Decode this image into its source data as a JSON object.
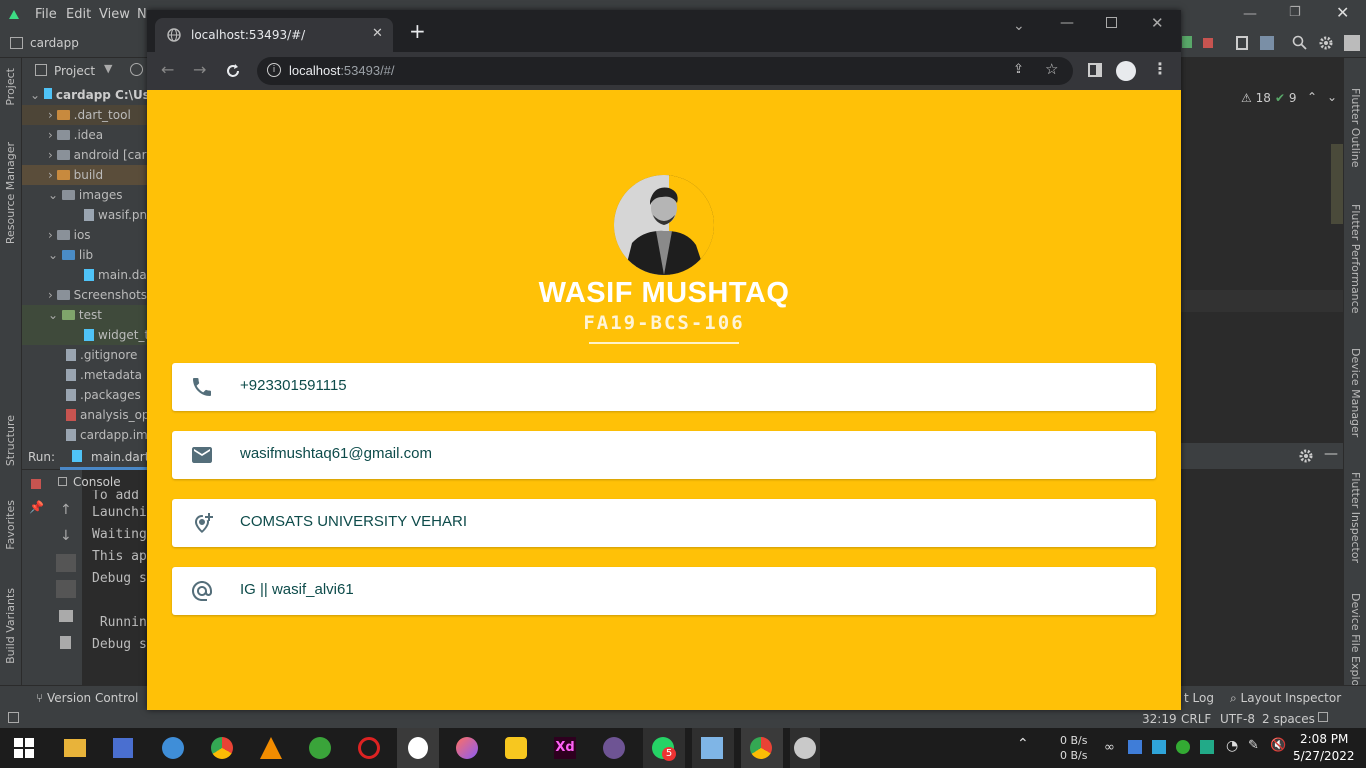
{
  "ide": {
    "menu": [
      "File",
      "Edit",
      "View",
      "N"
    ],
    "project_name": "cardapp",
    "project_tab": "Project",
    "left_tabs": [
      "Project",
      "Resource Manager",
      "Structure",
      "Favorites",
      "Build Variants"
    ],
    "right_tabs": [
      "Flutter Outline",
      "Flutter Performance",
      "Device Manager",
      "Flutter Inspector",
      "Device File Explor"
    ],
    "tree": [
      {
        "label": "cardapp C:\\Use",
        "kind": "root"
      },
      {
        "label": ".dart_tool",
        "kind": "folder-orange"
      },
      {
        "label": ".idea",
        "kind": "folder"
      },
      {
        "label": "android [car",
        "kind": "folder"
      },
      {
        "label": "build",
        "kind": "folder-orange"
      },
      {
        "label": "images",
        "kind": "folder"
      },
      {
        "label": "wasif.png",
        "kind": "file"
      },
      {
        "label": "ios",
        "kind": "folder"
      },
      {
        "label": "lib",
        "kind": "folder-blue"
      },
      {
        "label": "main.dar",
        "kind": "file"
      },
      {
        "label": "Screenshots",
        "kind": "folder"
      },
      {
        "label": "test",
        "kind": "folder"
      },
      {
        "label": "widget_t",
        "kind": "file"
      },
      {
        "label": ".gitignore",
        "kind": "file"
      },
      {
        "label": ".metadata",
        "kind": "file"
      },
      {
        "label": ".packages",
        "kind": "file"
      },
      {
        "label": "analysis_opt",
        "kind": "file"
      },
      {
        "label": "cardapp.iml",
        "kind": "file"
      }
    ],
    "run_label": "Run:",
    "run_file": "main.dart",
    "console_tab": "Console",
    "console_lines": [
      "To add",
      "Launchi",
      "Waiting",
      "This ap",
      "Debug s",
      "",
      " Runnin",
      "Debug s"
    ],
    "warnings": "18",
    "checks": "9",
    "status": {
      "version_control": "Version Control",
      "event_log": "t Log",
      "layout_inspector": "Layout Inspector",
      "position": "32:19",
      "line_sep": "CRLF",
      "encoding": "UTF-8",
      "indent": "2 spaces"
    }
  },
  "browser": {
    "tab_title": "localhost:53493/#/",
    "url_host": "localhost",
    "url_rest": ":53493/#/"
  },
  "profile": {
    "name": "WASIF MUSHTAQ",
    "regno": "FA19-BCS-106",
    "background": "#ffc107",
    "cards": [
      {
        "icon": "phone-icon",
        "text": "+923301591115"
      },
      {
        "icon": "mail-icon",
        "text": "wasifmushtaq61@gmail.com"
      },
      {
        "icon": "location-add-icon",
        "text": "COMSATS UNIVERSITY VEHARI"
      },
      {
        "icon": "at-sign-icon",
        "text": "IG || wasif_alvi61"
      }
    ]
  },
  "taskbar": {
    "net_up": "0 B/s",
    "net_down": "0 B/s",
    "time": "2:08 PM",
    "date": "5/27/2022",
    "whatsapp_badge": "5"
  }
}
